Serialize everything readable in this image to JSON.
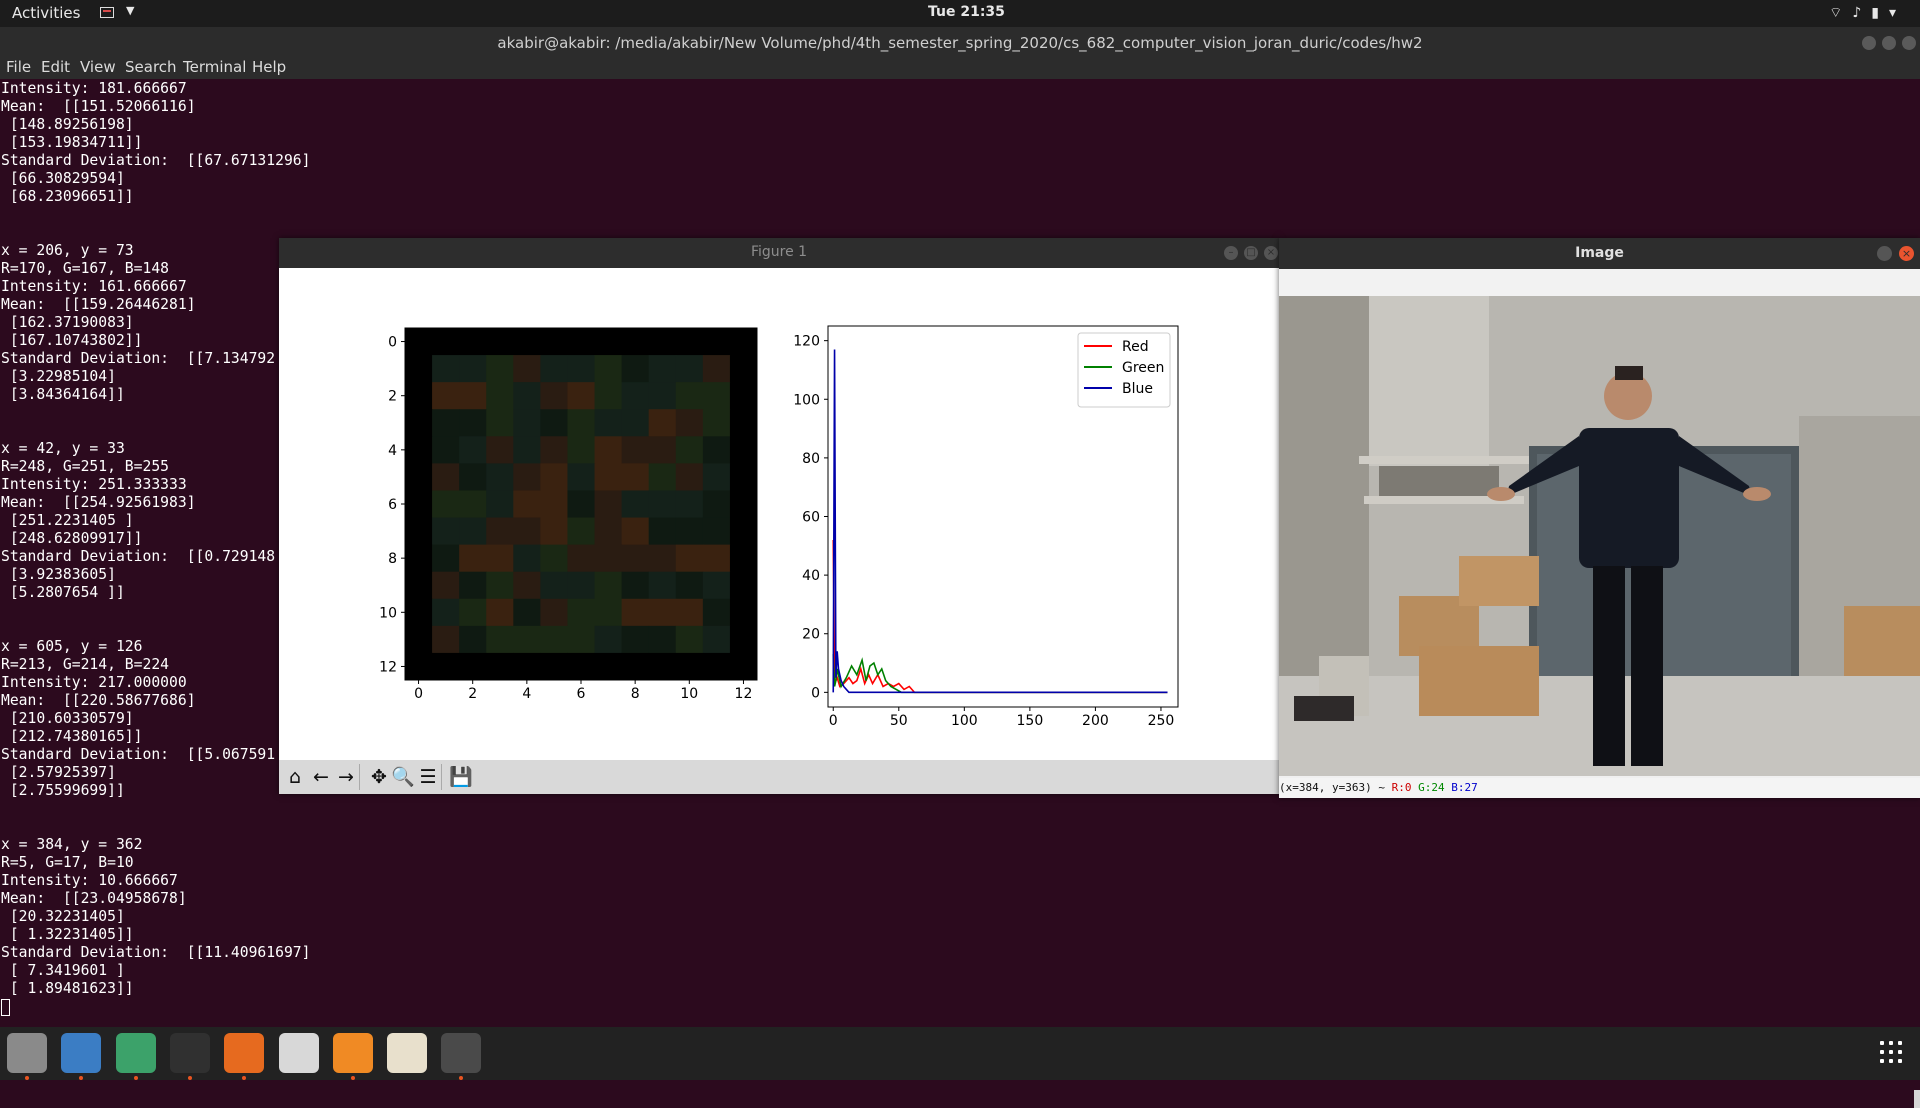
{
  "topbar": {
    "activities": "Activities",
    "clock": "Tue 21:35",
    "icons": [
      "keyboard-layout-icon",
      "wifi-icon",
      "volume-icon",
      "battery-icon",
      "system-menu-chevron-icon"
    ]
  },
  "terminal": {
    "title": "akabir@akabir: /media/akabir/New Volume/phd/4th_semester_spring_2020/cs_682_computer_vision_joran_duric/codes/hw2",
    "menu": [
      "File",
      "Edit",
      "View",
      "Search",
      "Terminal",
      "Help"
    ],
    "lines": [
      "Intensity: 181.666667",
      "Mean:  [[151.52066116]",
      " [148.89256198]",
      " [153.19834711]]",
      "Standard Deviation:  [[67.67131296]",
      " [66.30829594]",
      " [68.23096651]]",
      "",
      "",
      "x = 206, y = 73",
      "R=170, G=167, B=148",
      "Intensity: 161.666667",
      "Mean:  [[159.26446281]",
      " [162.37190083]",
      " [167.10743802]]",
      "Standard Deviation:  [[7.134792",
      " [3.22985104]",
      " [3.84364164]]",
      "",
      "",
      "x = 42, y = 33",
      "R=248, G=251, B=255",
      "Intensity: 251.333333",
      "Mean:  [[254.92561983]",
      " [251.2231405 ]",
      " [248.62809917]]",
      "Standard Deviation:  [[0.729148",
      " [3.92383605]",
      " [5.2807654 ]]",
      "",
      "",
      "x = 605, y = 126",
      "R=213, G=214, B=224",
      "Intensity: 217.000000",
      "Mean:  [[220.58677686]",
      " [210.60330579]",
      " [212.74380165]]",
      "Standard Deviation:  [[5.067591",
      " [2.57925397]",
      " [2.75599699]]",
      "",
      "",
      "x = 384, y = 362",
      "R=5, G=17, B=10",
      "Intensity: 10.666667",
      "Mean:  [[23.04958678]",
      " [20.32231405]",
      " [ 1.32231405]]",
      "Standard Deviation:  [[11.40961697]",
      " [ 7.3419601 ]",
      " [ 1.89481623]]"
    ]
  },
  "figure": {
    "title": "Figure 1",
    "toolbar": [
      {
        "name": "home-icon",
        "glyph": "⌂"
      },
      {
        "name": "back-arrow-icon",
        "glyph": "←"
      },
      {
        "name": "forward-arrow-icon",
        "glyph": "→"
      },
      {
        "name": "pan-icon",
        "glyph": "✥"
      },
      {
        "name": "zoom-icon",
        "glyph": "🔍"
      },
      {
        "name": "configure-subplots-icon",
        "glyph": "☰"
      },
      {
        "name": "save-icon",
        "glyph": "💾"
      }
    ]
  },
  "chart_data": [
    {
      "type": "heatmap",
      "title": "",
      "xticks": [
        "0",
        "2",
        "4",
        "6",
        "8",
        "10",
        "12"
      ],
      "yticks": [
        "0",
        "2",
        "4",
        "6",
        "8",
        "10",
        "12"
      ],
      "xlim": [
        -0.5,
        12.5
      ],
      "ylim": [
        12.5,
        -0.5
      ],
      "note_colors": [
        "#000000",
        "#1a2814",
        "#2a1c12",
        "#14211a",
        "#3a2210",
        "#0f1a12"
      ]
    },
    {
      "type": "line",
      "title": "",
      "xlabel": "",
      "ylabel": "",
      "xlim": [
        0,
        255
      ],
      "ylim": [
        0,
        120
      ],
      "xticks": [
        0,
        50,
        100,
        150,
        200,
        250
      ],
      "yticks": [
        0,
        20,
        40,
        60,
        80,
        100,
        120
      ],
      "legend_position": "top-right",
      "series": [
        {
          "name": "Red",
          "color": "#ff0000",
          "x": [
            0,
            1,
            2,
            3,
            5,
            8,
            12,
            15,
            18,
            21,
            24,
            27,
            30,
            34,
            38,
            42,
            46,
            50,
            54,
            58,
            62,
            255
          ],
          "y": [
            52,
            3,
            4,
            5,
            2,
            3,
            5,
            3,
            4,
            8,
            3,
            6,
            3,
            6,
            2,
            3,
            2,
            3,
            1,
            2,
            0,
            0
          ]
        },
        {
          "name": "Green",
          "color": "#008000",
          "x": [
            0,
            1,
            2,
            3,
            6,
            10,
            14,
            18,
            22,
            25,
            28,
            31,
            34,
            37,
            40,
            44,
            48,
            52,
            56,
            255
          ],
          "y": [
            13,
            2,
            4,
            8,
            2,
            5,
            9,
            6,
            11,
            4,
            9,
            10,
            6,
            8,
            4,
            2,
            1,
            0,
            0,
            0
          ]
        },
        {
          "name": "Blue",
          "color": "#0000aa",
          "x": [
            0,
            1,
            2,
            3,
            4,
            5,
            6,
            8,
            10,
            12,
            255
          ],
          "y": [
            0,
            117,
            5,
            14,
            8,
            6,
            4,
            2,
            1,
            0,
            0
          ]
        }
      ]
    }
  ],
  "image_window": {
    "title": "Image",
    "status": {
      "coords": "(x=384, y=363) ~ ",
      "r": "R:0",
      "g": "G:24",
      "b": "B:27"
    }
  },
  "dock": [
    {
      "name": "files-icon",
      "color": "#8a8a8a"
    },
    {
      "name": "text-editor-icon",
      "color": "#3b7dc4"
    },
    {
      "name": "atom-icon",
      "color": "#3ca26a"
    },
    {
      "name": "terminal-icon",
      "color": "#303030"
    },
    {
      "name": "firefox-icon",
      "color": "#e66a1f"
    },
    {
      "name": "notes-icon",
      "color": "#d8d8d8"
    },
    {
      "name": "pdf-viewer-icon",
      "color": "#f08a24"
    },
    {
      "name": "kolourpaint-icon",
      "color": "#e8e0cc"
    },
    {
      "name": "opencv-window-icon",
      "color": "#4a4a4a"
    }
  ]
}
